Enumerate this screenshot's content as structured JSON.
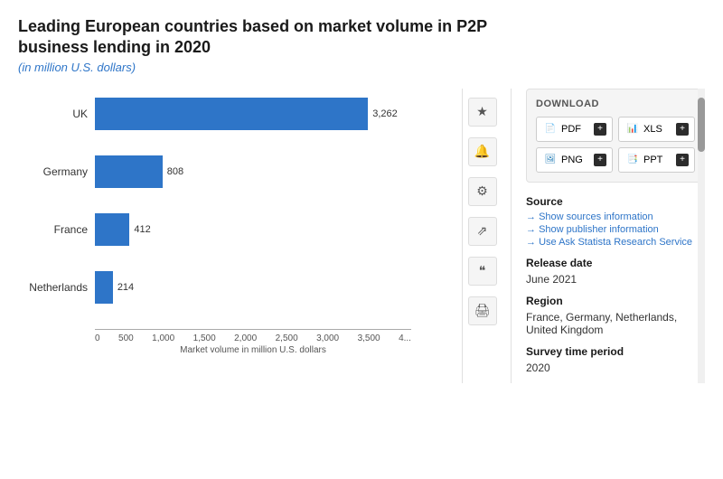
{
  "title": {
    "main": "Leading European countries based on market volume in P2P business lending in 2020",
    "subtitle": "(in million U.S. dollars)"
  },
  "chart": {
    "bars": [
      {
        "label": "UK",
        "value": 3262,
        "display": "3,262",
        "width_pct": 93
      },
      {
        "label": "Germany",
        "value": 808,
        "display": "808",
        "width_pct": 23
      },
      {
        "label": "France",
        "value": 412,
        "display": "412",
        "width_pct": 11.8
      },
      {
        "label": "Netherlands",
        "value": 214,
        "display": "214",
        "width_pct": 6.1
      }
    ],
    "x_axis_labels": [
      "0",
      "500",
      "1,000",
      "1,500",
      "2,000",
      "2,500",
      "3,000",
      "3,500",
      "4..."
    ],
    "x_axis_title": "Market volume in million U.S. dollars"
  },
  "icon_sidebar": {
    "icons": [
      {
        "name": "star",
        "symbol": "★"
      },
      {
        "name": "bell",
        "symbol": "🔔"
      },
      {
        "name": "gear",
        "symbol": "⚙"
      },
      {
        "name": "share",
        "symbol": "⇗"
      },
      {
        "name": "quote",
        "symbol": "❝"
      },
      {
        "name": "print",
        "symbol": "🖨"
      }
    ]
  },
  "download": {
    "label": "DOWNLOAD",
    "buttons": [
      {
        "type": "PDF",
        "color": "pdf"
      },
      {
        "type": "XLS",
        "color": "xls"
      },
      {
        "type": "PNG",
        "color": "png"
      },
      {
        "type": "PPT",
        "color": "ppt"
      }
    ]
  },
  "source_section": {
    "label": "Source",
    "links": [
      "Show sources information",
      "Show publisher information",
      "Use Ask Statista Research Service"
    ]
  },
  "release_date": {
    "label": "Release date",
    "value": "June 2021"
  },
  "region": {
    "label": "Region",
    "value": "France, Germany, Netherlands, United Kingdom"
  },
  "survey_time_period": {
    "label": "Survey time period",
    "value": "2020"
  }
}
